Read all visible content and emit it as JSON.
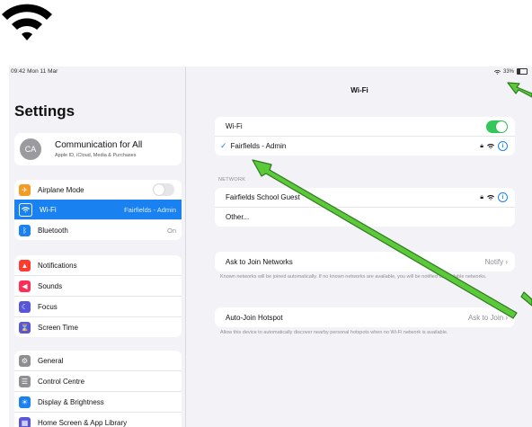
{
  "status": {
    "time": "09:42  Mon 11 Mar",
    "battery": "33%"
  },
  "sidebar": {
    "title": "Settings",
    "profile": {
      "initials": "CA",
      "name": "Communication for All",
      "subtitle": "Apple ID, iCloud, Media & Purchases"
    },
    "group1": [
      {
        "label": "Airplane Mode",
        "icon": "airplane-icon",
        "color": "#f59a23",
        "value": ""
      },
      {
        "label": "Wi-Fi",
        "icon": "wifi-icon",
        "color": "#1a82f0",
        "value": "Fairfields - Admin"
      },
      {
        "label": "Bluetooth",
        "icon": "bluetooth-icon",
        "color": "#1a82f0",
        "value": "On"
      }
    ],
    "group2": [
      {
        "label": "Notifications",
        "icon": "bell-icon",
        "color": "#ff3b30"
      },
      {
        "label": "Sounds",
        "icon": "speaker-icon",
        "color": "#ff2d55"
      },
      {
        "label": "Focus",
        "icon": "moon-icon",
        "color": "#5856d6"
      },
      {
        "label": "Screen Time",
        "icon": "hourglass-icon",
        "color": "#5856d6"
      }
    ],
    "group3": [
      {
        "label": "General",
        "icon": "gear-icon",
        "color": "#8e8e93"
      },
      {
        "label": "Control Centre",
        "icon": "switches-icon",
        "color": "#8e8e93"
      },
      {
        "label": "Display & Brightness",
        "icon": "sun-icon",
        "color": "#1a82f0"
      },
      {
        "label": "Home Screen & App Library",
        "icon": "grid-icon",
        "color": "#5856d6"
      }
    ]
  },
  "detail": {
    "title": "Wi-Fi",
    "wifi_label": "Wi-Fi",
    "connected": "Fairfields - Admin",
    "networks_header": "NETWORK",
    "networks": [
      "Fairfields School Guest",
      "Other..."
    ],
    "ask_join": {
      "label": "Ask to Join Networks",
      "value": "Notify",
      "footer": "Known networks will be joined automatically. If no known networks are available, you will be notified of available networks."
    },
    "auto_join": {
      "label": "Auto-Join Hotspot",
      "value": "Ask to Join",
      "footer": "Allow this device to automatically discover nearby personal hotspots when no Wi-Fi network is available."
    }
  },
  "colors": {
    "accent": "#1a82f0",
    "toggle_on": "#34c759",
    "arrow": "#5cc93a"
  }
}
